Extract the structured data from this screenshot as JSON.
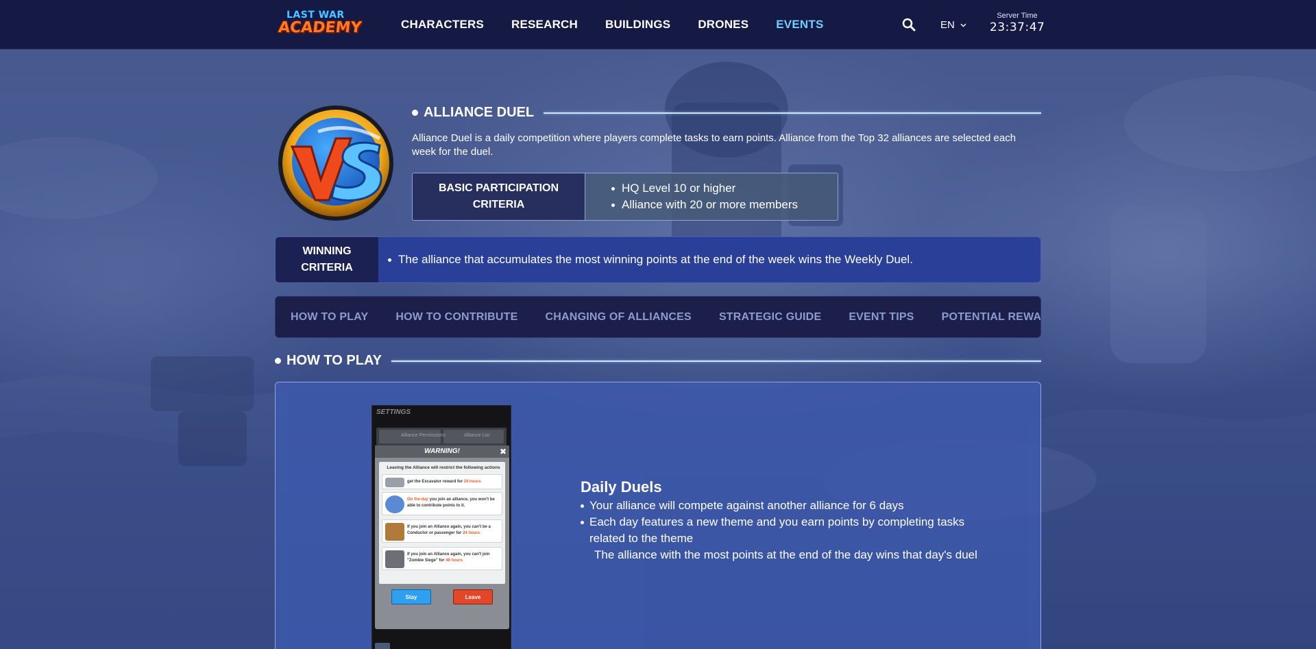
{
  "logo": {
    "line1": "LAST WAR",
    "line2": "ACADEMY"
  },
  "nav": {
    "links": [
      {
        "label": "CHARACTERS"
      },
      {
        "label": "RESEARCH"
      },
      {
        "label": "BUILDINGS"
      },
      {
        "label": "DRONES"
      },
      {
        "label": "EVENTS",
        "active": true
      }
    ],
    "search_icon": "search-icon",
    "language": "EN",
    "server_time_label": "Server Time",
    "server_time": "23:37:47"
  },
  "event": {
    "title": "ALLIANCE DUEL",
    "description": "Alliance Duel is a daily competition where players complete tasks to earn points. Alliance from the Top 32 alliances are selected each week for the duel.",
    "participation_label": "BASIC PARTICIPATION CRITERIA",
    "participation_items": [
      "HQ Level 10 or higher",
      "Alliance with 20 or more members"
    ],
    "winning_label": "WINNING CRITERIA",
    "winning_item": "The alliance that accumulates the most winning points at the end of the week wins the Weekly Duel."
  },
  "tabs": [
    "HOW TO PLAY",
    "HOW TO CONTRIBUTE",
    "CHANGING OF ALLIANCES",
    "STRATEGIC GUIDE",
    "EVENT TIPS",
    "POTENTIAL REWARI"
  ],
  "how_to_play": {
    "title": "HOW TO PLAY",
    "screenshot": {
      "header": "SETTINGS",
      "tab1": "Alliance Permissions",
      "tab2": "Alliance List",
      "dialog_title": "WARNING!",
      "intro": "Leaving the Alliance will restrict the following actions",
      "rows": [
        {
          "pre": "get the Excavator reward for ",
          "highlight": "24 hours",
          "post": ""
        },
        {
          "pre": "",
          "highlight": "On the day",
          "post": " you join an alliance, you won't be able to contribute points to it."
        },
        {
          "pre": "If you join an Alliance again, you can't be a Conductor or passenger for ",
          "highlight": "24 hours",
          "post": ""
        },
        {
          "pre": "If you join an Alliance again, you can't join \"Zombie Siege\" for ",
          "highlight": "48 hours",
          "post": ""
        }
      ],
      "stay": "Stay",
      "leave": "Leave"
    },
    "daily_title": "Daily Duels",
    "daily_items": [
      "Your alliance will compete against another alliance for 6 days",
      "Each day features a new theme and you earn points by completing tasks related to the theme"
    ],
    "daily_continuation": "The alliance with the most points at the end of the day wins that day's duel"
  },
  "colors": {
    "nav_bg": "#151a45",
    "active_link": "#6fd0ff",
    "card_bg": "#3e5aaf",
    "tab_bar": "#1b1f4a",
    "winning_bar": "#2a3f97"
  }
}
